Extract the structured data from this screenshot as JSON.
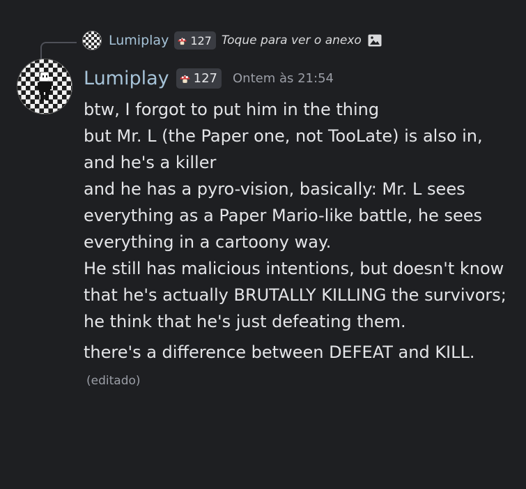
{
  "reply": {
    "author": "Lumiplay",
    "badge_count": "127",
    "preview_text": "Toque para ver o anexo",
    "icons": {
      "avatar": "checkered-avatar",
      "badge": "red-mushroom-icon",
      "attachment": "image-icon"
    }
  },
  "message": {
    "author": "Lumiplay",
    "badge_count": "127",
    "timestamp": "Ontem às 21:54",
    "paragraphs": [
      "btw, I forgot to put him in the thing\nbut Mr. L (the Paper one, not TooLate) is also in, and he's a killer\nand he has a pyro-vision, basically: Mr. L sees everything as a Paper Mario-like battle, he sees everything in a cartoony way.\nHe still has malicious intentions, but doesn't know that he's actually BRUTALLY KILLING the survivors; he think that he's just defeating them.",
      "there's a difference between DEFEAT and KILL."
    ],
    "edited_label": "(editado)"
  },
  "colors": {
    "background": "#1e1f22",
    "username": "#a6c3d8",
    "text": "#e4e5e8",
    "muted": "#9b9ea6",
    "badge_bg": "#3a3c42",
    "mushroom_red": "#d63b3b"
  }
}
